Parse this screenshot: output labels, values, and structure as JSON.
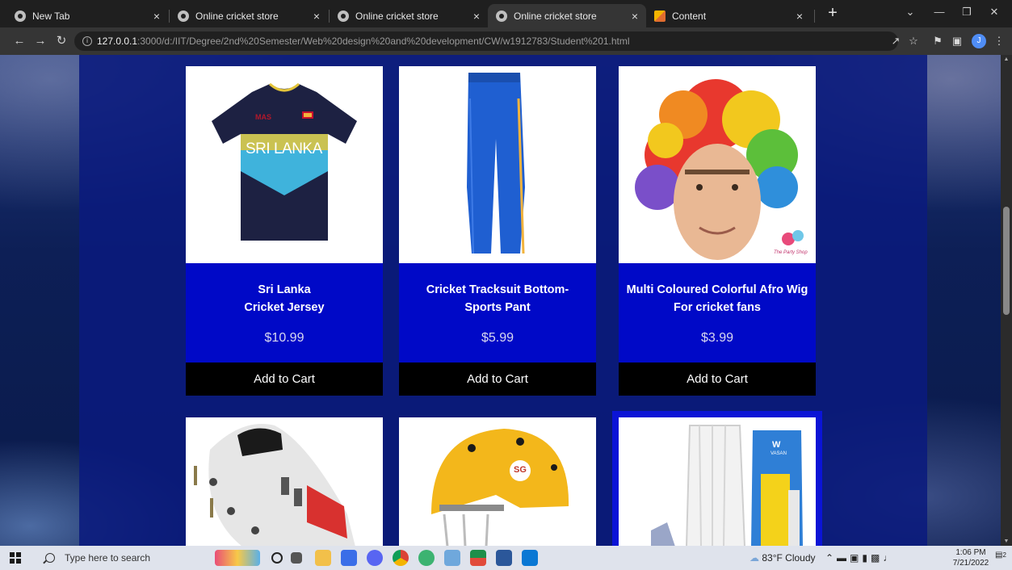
{
  "browser": {
    "tabs": [
      {
        "title": "New Tab",
        "favicon": "chrome-icon",
        "active": false
      },
      {
        "title": "Online cricket store",
        "favicon": "globe-icon",
        "active": false
      },
      {
        "title": "Online cricket store",
        "favicon": "globe-icon",
        "active": false
      },
      {
        "title": "Online cricket store",
        "favicon": "globe-icon",
        "active": true
      },
      {
        "title": "Content",
        "favicon": "content-icon",
        "active": false
      }
    ],
    "close_glyph": "×",
    "new_tab_glyph": "+",
    "url_host": "127.0.0.1",
    "url_path": ":3000/d:/IIT/Degree/2nd%20Semester/Web%20design%20and%20development/CW/w1912783/Student%201.html",
    "profile_initial": "J"
  },
  "products": [
    {
      "title_line1": "Sri Lanka",
      "title_line2": "Cricket Jersey",
      "price": "$10.99",
      "button": "Add to Cart"
    },
    {
      "title_line1": "Cricket Tracksuit Bottom-",
      "title_line2": "Sports Pant",
      "price": "$5.99",
      "button": "Add to Cart"
    },
    {
      "title_line1": "Multi Coloured Colorful Afro Wig",
      "title_line2": "For cricket fans",
      "price": "$3.99",
      "button": "Add to Cart"
    }
  ],
  "product_images": {
    "jersey_brand": "MAS",
    "jersey_text": "SRI LANKA",
    "wig_logo": "The Party Shop",
    "helmet_logo": "SG",
    "pads_brand": "W",
    "pads_text": "VASAN"
  },
  "taskbar": {
    "search_placeholder": "Type here to search",
    "weather": "83°F  Cloudy",
    "time": "1:06 PM",
    "date": "7/21/2022",
    "notification_count": "2"
  },
  "colors": {
    "card_info_bg": "#0009c7",
    "cart_button_bg": "#000000",
    "panel_bg": "#0a1a7d"
  }
}
